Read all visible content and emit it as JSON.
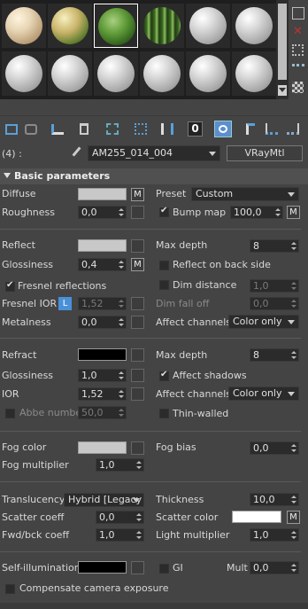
{
  "header": {
    "index_label": "(4) :",
    "material_name": "AM255_014_004",
    "material_type": "VRayMtl",
    "zero_label": "0"
  },
  "rollout": {
    "title": "Basic parameters"
  },
  "diffuse": {
    "label": "Diffuse",
    "m": "M",
    "preset_label": "Preset",
    "preset_value": "Custom",
    "color": "#c8c8c8"
  },
  "roughness": {
    "label": "Roughness",
    "value": "0,0",
    "bump_label": "Bump map",
    "bump_value": "100,0",
    "m": "M"
  },
  "reflect": {
    "label": "Reflect",
    "color": "#c8c8c8",
    "maxdepth_label": "Max depth",
    "maxdepth_value": "8"
  },
  "glossiness": {
    "label": "Glossiness",
    "value": "0,4",
    "m": "M",
    "backside_label": "Reflect on back side"
  },
  "fresnel": {
    "label": "Fresnel reflections",
    "dimdist_label": "Dim distance",
    "dimdist_value": "1,0"
  },
  "fresnel_ior": {
    "label": "Fresnel IOR",
    "l": "L",
    "value": "1,52",
    "dimfall_label": "Dim fall off",
    "dimfall_value": "0,0"
  },
  "metalness": {
    "label": "Metalness",
    "value": "0,0",
    "affect_label": "Affect channels",
    "affect_value": "Color only"
  },
  "refract": {
    "label": "Refract",
    "color": "#000000",
    "maxdepth_label": "Max depth",
    "maxdepth_value": "8"
  },
  "refr_gloss": {
    "label": "Glossiness",
    "value": "1,0",
    "shadows_label": "Affect shadows"
  },
  "ior": {
    "label": "IOR",
    "value": "1,52",
    "affect_label": "Affect channels",
    "affect_value": "Color only"
  },
  "abbe": {
    "label": "Abbe number",
    "value": "50,0",
    "thin_label": "Thin-walled"
  },
  "fog": {
    "color_label": "Fog color",
    "color": "#c8c8c8",
    "bias_label": "Fog bias",
    "bias_value": "0,0",
    "mult_label": "Fog multiplier",
    "mult_value": "1,0"
  },
  "translucency": {
    "label": "Translucency",
    "value": "Hybrid [Legacy",
    "thickness_label": "Thickness",
    "thickness_value": "10,0"
  },
  "scatter": {
    "label": "Scatter coeff",
    "value": "0,0",
    "color_label": "Scatter color",
    "color": "#ffffff",
    "m": "M"
  },
  "fwdbck": {
    "label": "Fwd/bck coeff",
    "value": "1,0",
    "light_label": "Light multiplier",
    "light_value": "1,0"
  },
  "selfillum": {
    "label": "Self-illumination",
    "color": "#000000",
    "gi_label": "GI",
    "mult_label": "Mult",
    "mult_value": "0,0"
  },
  "compensate": {
    "label": "Compensate camera exposure"
  },
  "colors": {
    "panel": "#444444",
    "field": "#2b2b2b",
    "accent_blue": "#4a90d9"
  }
}
